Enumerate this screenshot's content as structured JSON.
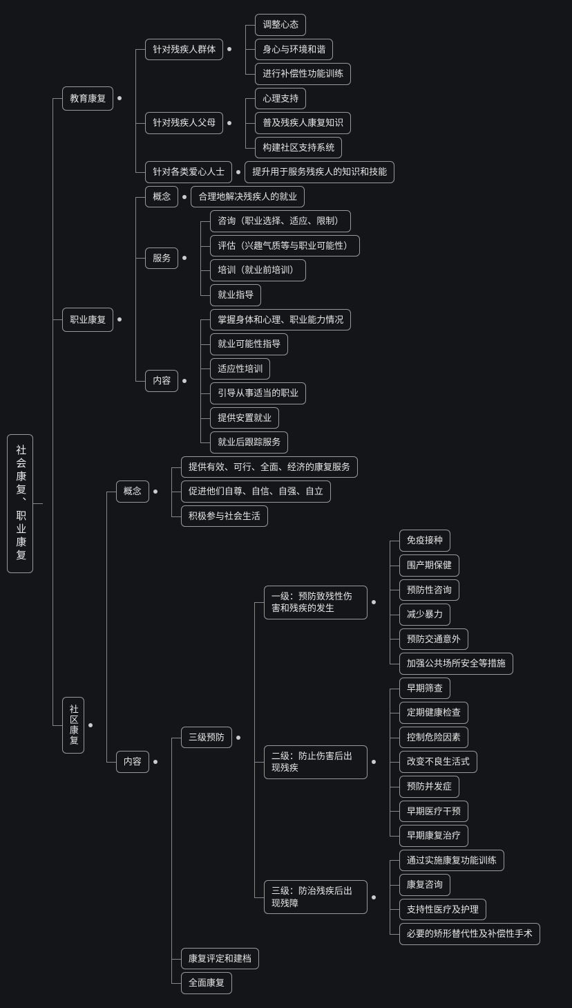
{
  "root": "社会康复、职业康复",
  "b1": {
    "label": "教育康复",
    "c1": {
      "label": "针对残疾人群体",
      "items": [
        "调整心态",
        "身心与环境和谐",
        "进行补偿性功能训练"
      ]
    },
    "c2": {
      "label": "针对残疾人父母",
      "items": [
        "心理支持",
        "普及残疾人康复知识",
        "构建社区支持系统"
      ]
    },
    "c3": {
      "label": "针对各类爱心人士",
      "item": "提升用于服务残疾人的知识和技能"
    }
  },
  "b2": {
    "label": "职业康复",
    "c1": {
      "label": "概念",
      "item": "合理地解决残疾人的就业"
    },
    "c2": {
      "label": "服务",
      "items": [
        "咨询（职业选择、适应、限制）",
        "评估（兴趣气质等与职业可能性）",
        "培训（就业前培训）",
        "就业指导"
      ]
    },
    "c3": {
      "label": "内容",
      "items": [
        "掌握身体和心理、职业能力情况",
        "就业可能性指导",
        "适应性培训",
        "引导从事适当的职业",
        "提供安置就业",
        "就业后跟踪服务"
      ]
    }
  },
  "b3": {
    "label": "社区康复",
    "c1": {
      "label": "概念",
      "items": [
        "提供有效、可行、全面、经济的康复服务",
        "促进他们自尊、自信、自强、自立",
        "积极参与社会生活"
      ]
    },
    "c2": {
      "label": "内容",
      "s1": {
        "label": "三级预防",
        "l1": {
          "label": "一级：预防致残性伤害和残疾的发生",
          "items": [
            "免疫接种",
            "围产期保健",
            "预防性咨询",
            "减少暴力",
            "预防交通意外",
            "加强公共场所安全等措施"
          ]
        },
        "l2": {
          "label": "二级：防止伤害后出现残疾",
          "items": [
            "早期筛查",
            "定期健康检查",
            "控制危险因素",
            "改变不良生活式",
            "预防并发症",
            "早期医疗干预",
            "早期康复治疗"
          ]
        },
        "l3": {
          "label": "三级：防治残疾后出现残障",
          "items": [
            "通过实施康复功能训练",
            "康复咨询",
            "支持性医疗及护理",
            "必要的矫形替代性及补偿性手术"
          ]
        }
      },
      "s2": "康复评定和建档",
      "s3": "全面康复"
    }
  }
}
